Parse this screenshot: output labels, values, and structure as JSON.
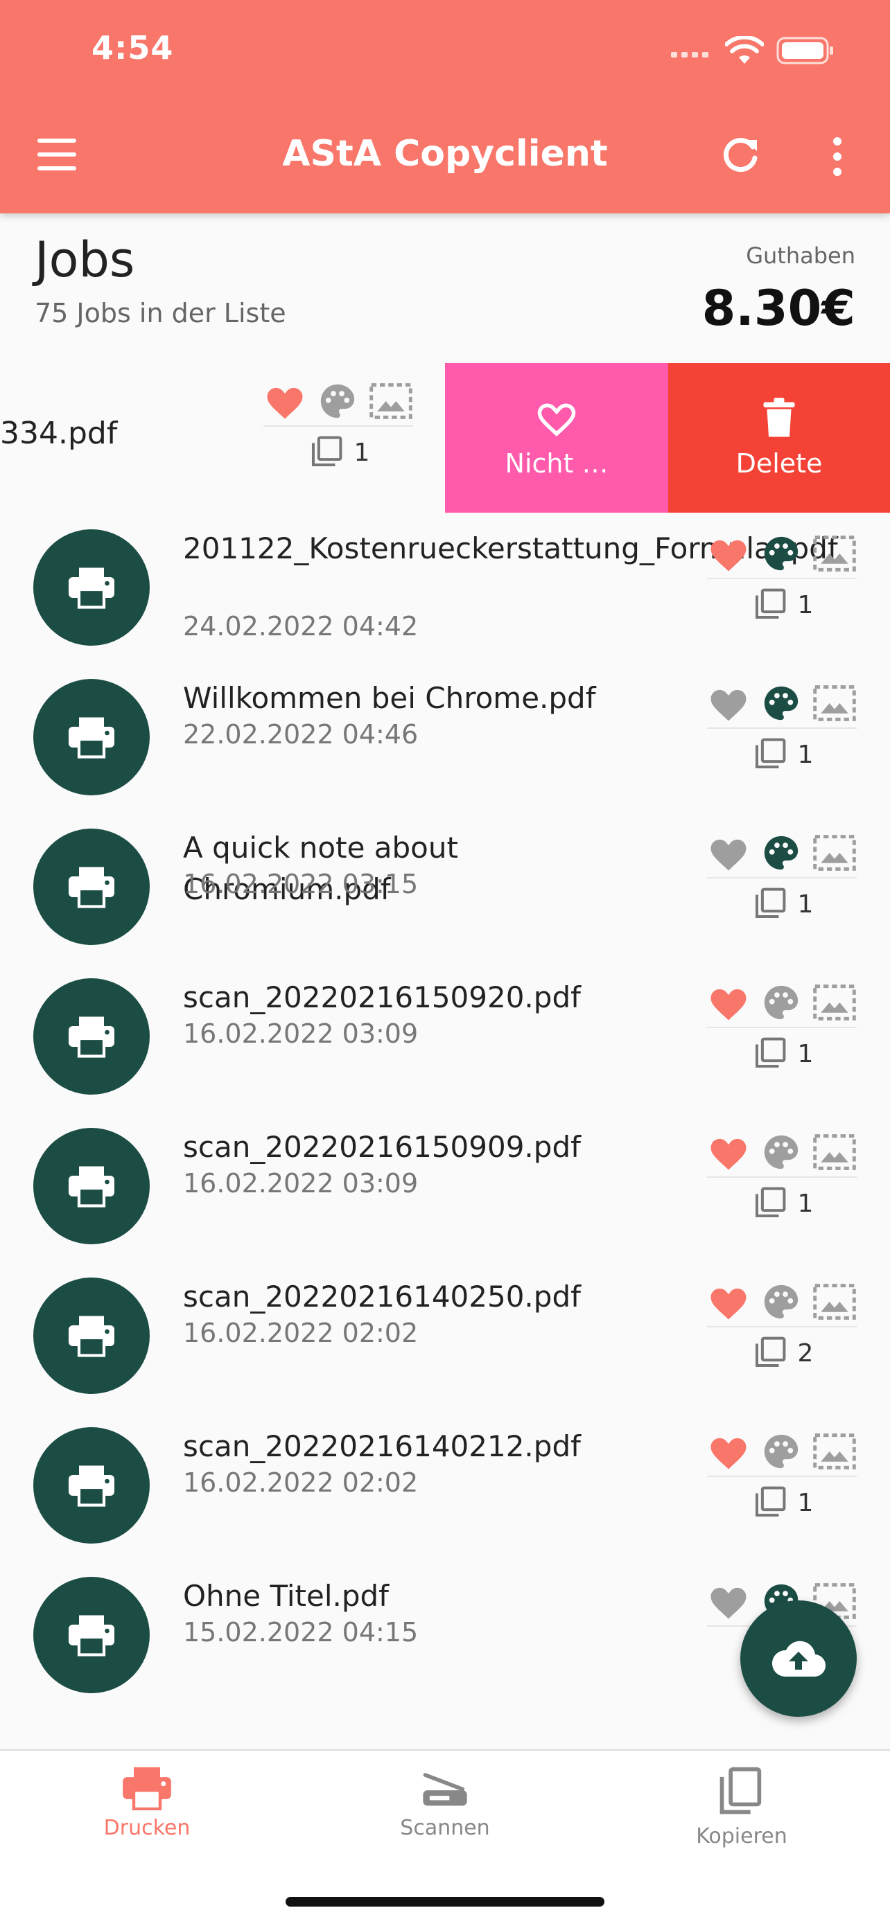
{
  "status": {
    "time": "4:54"
  },
  "appbar": {
    "title": "AStA Copyclient"
  },
  "jobs": {
    "title": "Jobs",
    "subtitle": "75 Jobs in der Liste",
    "credit_label": "Guthaben",
    "credit_value": "8.30€"
  },
  "swiped": {
    "name": "334.pdf",
    "copies": "1",
    "favorite_action": "Nicht …",
    "delete_action": "Delete"
  },
  "list": [
    {
      "name": "201122_Kostenrueckerstattung_Formular.pdf",
      "date": "24.02.2022 04:42",
      "copies": "1",
      "favorite": true,
      "color": true
    },
    {
      "name": "Willkommen bei Chrome.pdf",
      "date": "22.02.2022 04:46",
      "copies": "1",
      "favorite": false,
      "color": true
    },
    {
      "name": "A quick note about Chromium.pdf",
      "date": "16.02.2022 03:15",
      "copies": "1",
      "favorite": false,
      "color": true
    },
    {
      "name": "scan_20220216150920.pdf",
      "date": "16.02.2022 03:09",
      "copies": "1",
      "favorite": true,
      "color": false
    },
    {
      "name": "scan_20220216150909.pdf",
      "date": "16.02.2022 03:09",
      "copies": "1",
      "favorite": true,
      "color": false
    },
    {
      "name": "scan_20220216140250.pdf",
      "date": "16.02.2022 02:02",
      "copies": "2",
      "favorite": true,
      "color": false
    },
    {
      "name": "scan_20220216140212.pdf",
      "date": "16.02.2022 02:02",
      "copies": "1",
      "favorite": true,
      "color": false
    },
    {
      "name": "Ohne Titel.pdf",
      "date": "15.02.2022 04:15",
      "copies": "",
      "favorite": false,
      "color": true
    }
  ],
  "nav": {
    "print": "Drucken",
    "scan": "Scannen",
    "copy": "Kopieren"
  },
  "colors": {
    "brand": "#f9766a",
    "dark_green": "#1b4d45",
    "fav_action": "#ff5aab",
    "delete_action": "#f44336",
    "heart_on": "#f9766a",
    "icon_off": "#9e9e9e"
  }
}
